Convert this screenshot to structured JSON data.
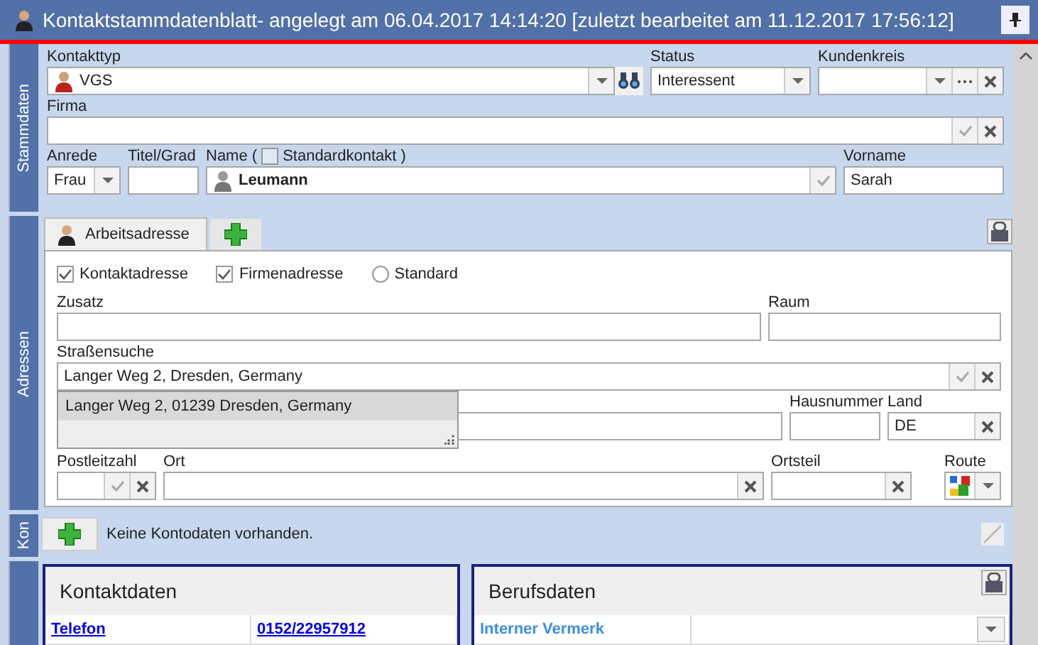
{
  "window": {
    "title": "Kontaktstammdatenblatt- angelegt am 06.04.2017 14:14:20 [zuletzt bearbeitet am 11.12.2017 17:56:12]"
  },
  "stammdaten": {
    "label": "Stammdaten",
    "kontakttyp": {
      "label": "Kontakttyp",
      "value": "VGS"
    },
    "status": {
      "label": "Status",
      "value": "Interessent"
    },
    "kundenkreis": {
      "label": "Kundenkreis"
    },
    "firma": {
      "label": "Firma"
    },
    "anrede": {
      "label": "Anrede",
      "value": "Frau"
    },
    "titel": {
      "label": "Titel/Grad"
    },
    "name": {
      "label": "Name (",
      "checkbox_label": "Standardkontakt )",
      "checked": false,
      "value": "Leumann"
    },
    "vorname": {
      "label": "Vorname",
      "value": "Sarah"
    }
  },
  "adressen": {
    "label": "Adressen",
    "tabs": [
      {
        "label": "Arbeitsadresse",
        "selected": true
      }
    ],
    "options": [
      {
        "kind": "checkbox",
        "label": "Kontaktadresse",
        "checked": true
      },
      {
        "kind": "checkbox",
        "label": "Firmenadresse",
        "checked": true
      },
      {
        "kind": "radio",
        "label": "Standard",
        "checked": false
      }
    ],
    "zusatz": {
      "label": "Zusatz"
    },
    "raum": {
      "label": "Raum"
    },
    "strassensuche": {
      "label": "Straßensuche",
      "value": "Langer Weg 2, Dresden, Germany"
    },
    "suggestions": [
      {
        "text": "Langer Weg 2, 01239 Dresden, Germany",
        "selected": true
      }
    ],
    "hausnummer": {
      "label": "Hausnummer"
    },
    "land": {
      "label": "Land",
      "value": "DE"
    },
    "postleitzahl": {
      "label": "Postleitzahl"
    },
    "ort": {
      "label": "Ort"
    },
    "ortsteil": {
      "label": "Ortsteil"
    },
    "route": {
      "label": "Route"
    }
  },
  "konto": {
    "label": "Kon",
    "message": "Keine Kontodaten vorhanden."
  },
  "kontaktdaten": {
    "title": "Kontaktdaten",
    "rows": [
      {
        "label": "Telefon",
        "value": "0152/22957912"
      }
    ]
  },
  "berufsdaten": {
    "title": "Berufsdaten",
    "rows": [
      {
        "label": "Interner Vermerk"
      }
    ]
  }
}
